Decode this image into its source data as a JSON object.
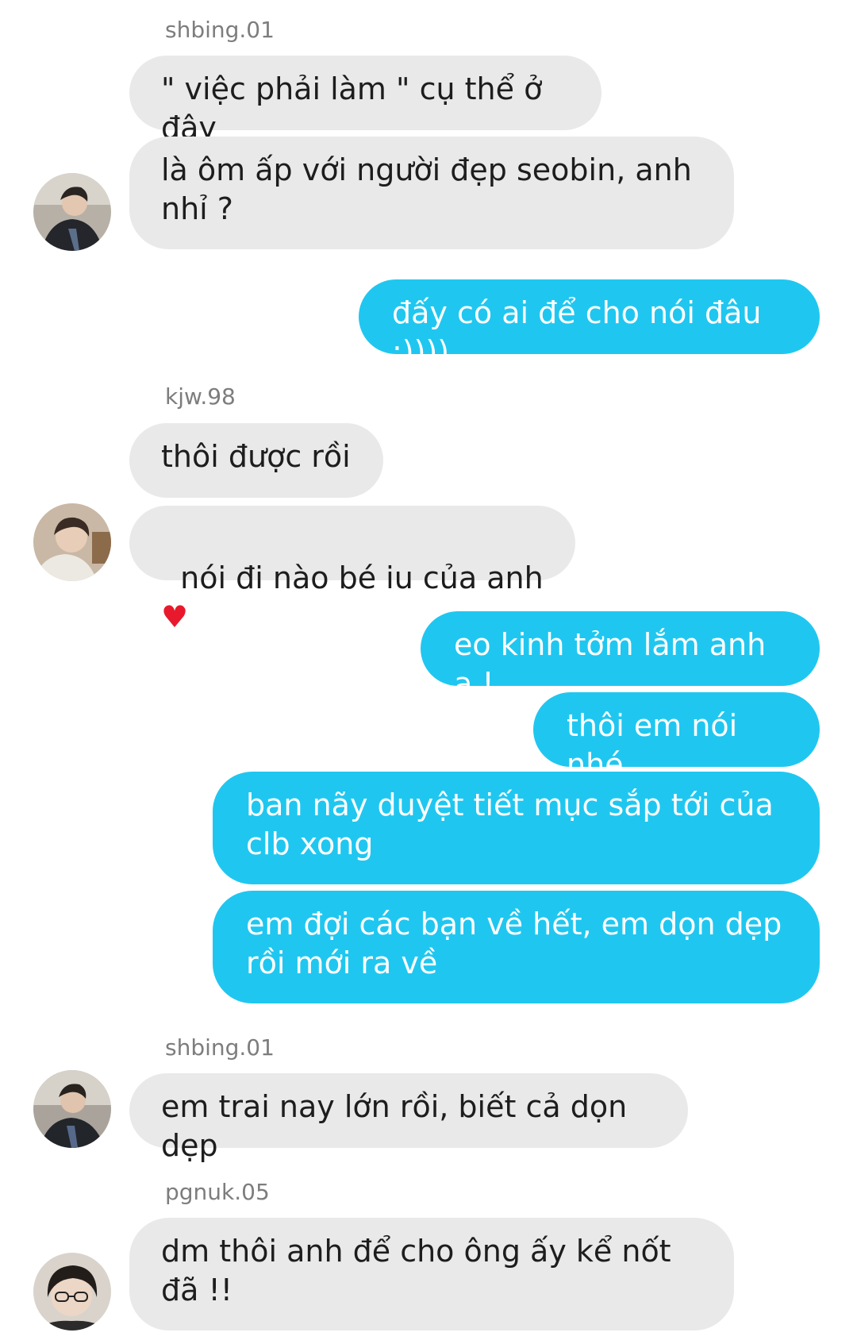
{
  "messages": [
    {
      "sender": "shbing.01"
    },
    {
      "text": "\" việc phải làm \" cụ thể ở đây"
    },
    {
      "text": "là ôm ấp với người đẹp seobin, anh nhỉ ?"
    },
    {
      "text": "đấy có ai để cho nói đâu :))))"
    },
    {
      "sender": "kjw.98"
    },
    {
      "text": "thôi được rồi"
    },
    {
      "text": "nói đi nào bé iu của anh",
      "emoji": "❤️"
    },
    {
      "text": "eo kinh tởm lắm anh ạ !"
    },
    {
      "text": "thôi em nói nhé"
    },
    {
      "text": "ban nãy duyệt tiết mục sắp tới của clb xong"
    },
    {
      "text": "em đợi các bạn về hết, em dọn dẹp rồi mới ra về"
    },
    {
      "sender": "shbing.01"
    },
    {
      "text": "em trai nay lớn rồi, biết cả dọn dẹp"
    },
    {
      "sender": "pgnuk.05"
    },
    {
      "text": "dm thôi anh để cho ông ấy kể nốt đã !!"
    }
  ],
  "colors": {
    "incoming_bubble": "#e9e9e9",
    "outgoing_bubble": "#1fc7f0",
    "sender_name": "#7d7d7d"
  }
}
